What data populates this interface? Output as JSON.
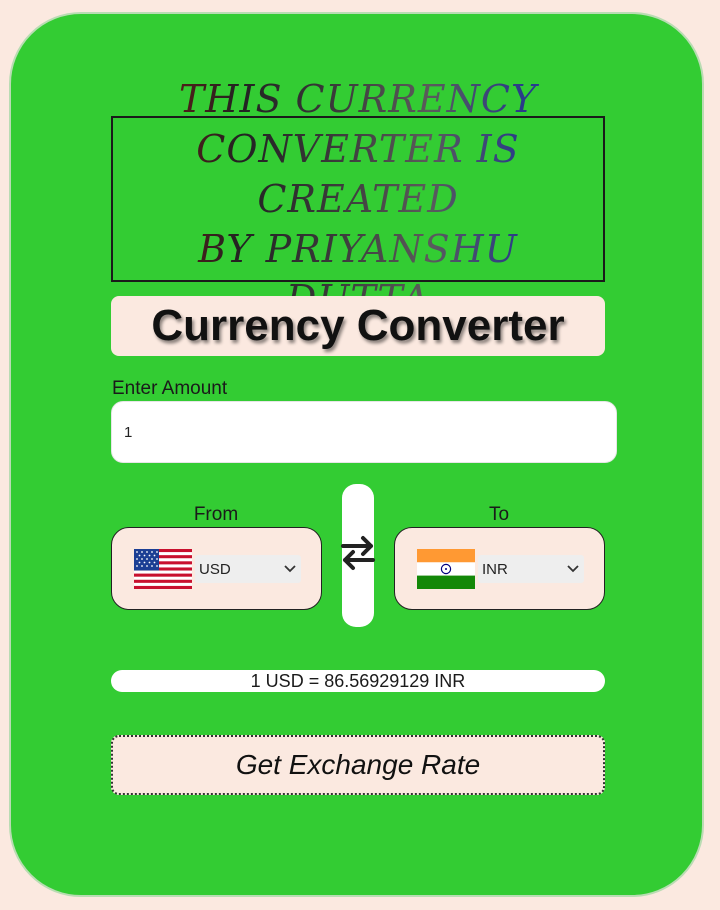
{
  "credit": {
    "lines": [
      "THIS CURRENCY",
      "CONVERTER IS CREATED",
      "BY PRIYANSHU DUTTA"
    ]
  },
  "header": {
    "title": "Currency Converter"
  },
  "amount": {
    "label": "Enter Amount",
    "value": "1"
  },
  "from": {
    "label": "From",
    "currency": "USD",
    "flag_icon": "us-flag-icon"
  },
  "to": {
    "label": "To",
    "currency": "INR",
    "flag_icon": "india-flag-icon"
  },
  "swap": {
    "icon": "swap-arrows-icon"
  },
  "result": {
    "text": "1 USD = 86.56929129 INR"
  },
  "action": {
    "label": "Get Exchange Rate"
  },
  "colors": {
    "card_bg": "#33cc33",
    "page_bg": "#fbe9e0",
    "panel_bg": "#fbe9e0"
  }
}
